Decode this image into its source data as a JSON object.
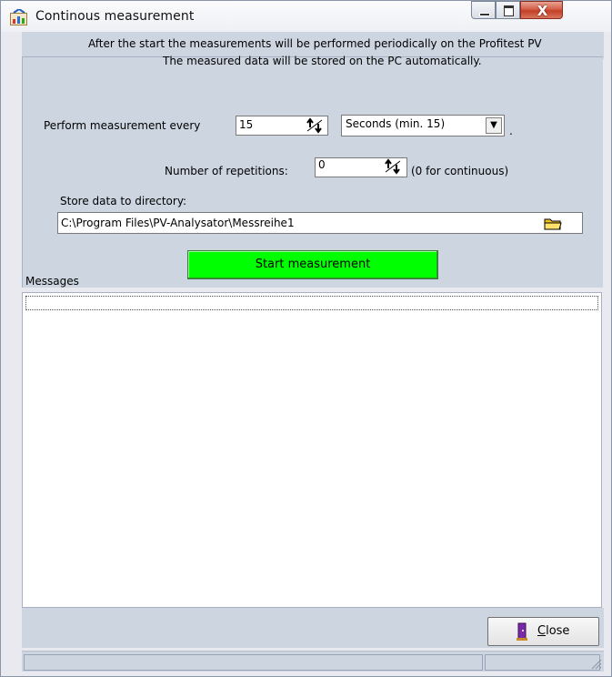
{
  "window": {
    "title": "Continous measurement",
    "close_glyph": "X"
  },
  "info": {
    "line1": "After the start the measurements will be performed periodically on the Profitest PV",
    "line2": "The measured data will be stored on the PC automatically."
  },
  "interval": {
    "label": "Perform measurement every",
    "value": "15",
    "unit": "Seconds (min. 15)",
    "suffix": "."
  },
  "repetitions": {
    "label": "Number of repetitions:",
    "value": "0",
    "hint": "(0 for continuous)"
  },
  "directory": {
    "label": "Store data to directory:",
    "value": "C:\\Program Files\\PV-Analysator\\Messreihe1"
  },
  "start_button": "Start measurement",
  "messages": {
    "label": "Messages"
  },
  "close_button": {
    "accel": "C",
    "rest": "lose"
  },
  "icons": {
    "app": "measurement-chart-icon",
    "spin": "spin-arrows-icon",
    "dropdown": "chevron-down-icon",
    "folder": "folder-icon",
    "close": "door-exit-icon"
  },
  "colors": {
    "panel": "#cdd5e1",
    "start_button": "#00ff00",
    "close_caption": "#c33f27"
  }
}
